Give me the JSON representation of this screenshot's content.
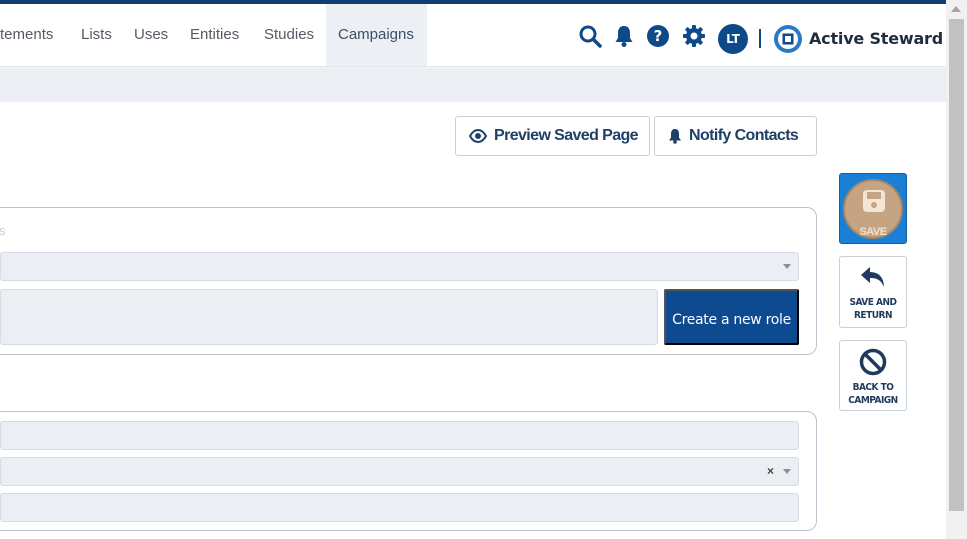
{
  "nav": {
    "items": [
      {
        "label": "tements"
      },
      {
        "label": "Lists"
      },
      {
        "label": "Uses"
      },
      {
        "label": "Entities"
      },
      {
        "label": "Studies"
      },
      {
        "label": "Campaigns",
        "active": true
      }
    ]
  },
  "header": {
    "avatar_initials": "LT",
    "brand_name": "Active Steward",
    "icons": [
      "search-icon",
      "bell-icon",
      "help-icon",
      "gear-icon"
    ]
  },
  "actions": {
    "preview_label": "Preview Saved Page",
    "notify_label": "Notify Contacts"
  },
  "role_panel": {
    "faint_label": "s",
    "create_role_label": "Create a new role"
  },
  "second_panel": {
    "clear_label": "×"
  },
  "sidebar": {
    "save_label": "SAVE",
    "save_return_line1": "SAVE AND",
    "save_return_line2": "RETURN",
    "back_line1": "BACK TO",
    "back_line2": "CAMPAIGN"
  },
  "colors": {
    "brand": "#0e4a8a",
    "primary_button": "#0d4a8f",
    "save_button": "#1a80d6",
    "field_bg": "#ebeef3"
  }
}
